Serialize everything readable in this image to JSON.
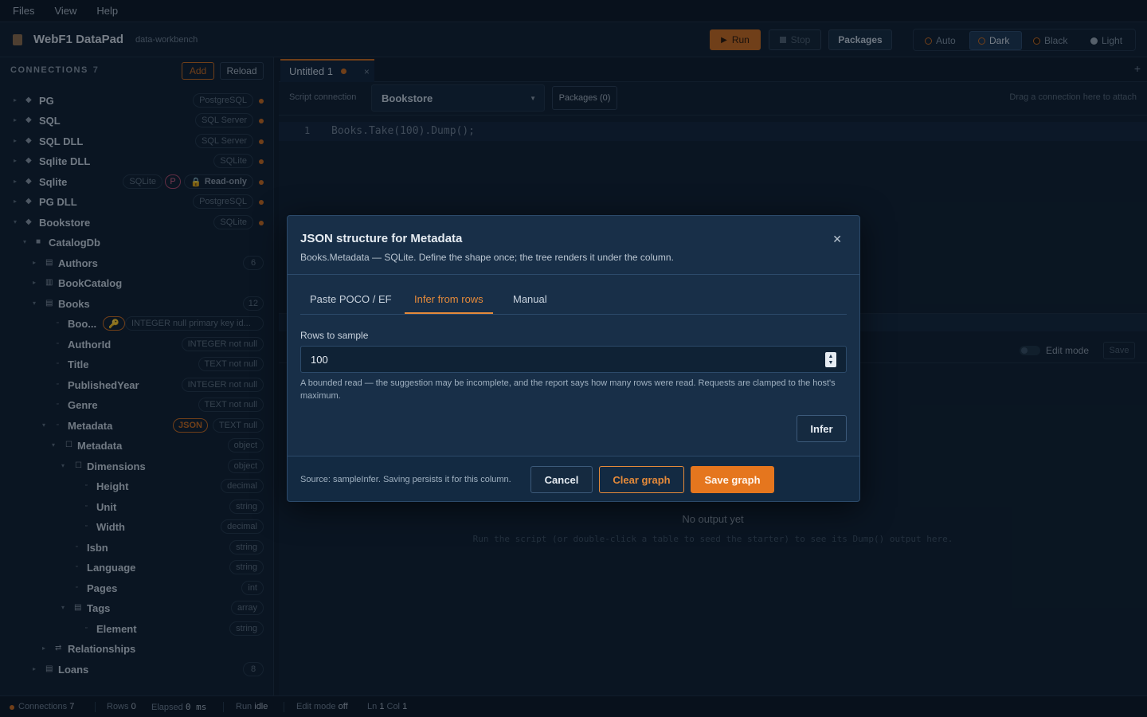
{
  "menu": [
    "Files",
    "View",
    "Help"
  ],
  "app": {
    "title": "WebF1 DataPad",
    "subtitle": "data-workbench"
  },
  "toolbar": {
    "run": "Run",
    "stop": "Stop",
    "packages": "Packages"
  },
  "themes": [
    "Auto",
    "Dark",
    "Black",
    "Light"
  ],
  "sidebar": {
    "title": "CONNECTIONS",
    "count": "7",
    "add": "Add",
    "reload": "Reload",
    "rows": [
      {
        "label": "PG",
        "tag": "PostgreSQL"
      },
      {
        "label": "SQL",
        "tag": "SQL Server"
      },
      {
        "label": "SQL DLL",
        "tag": "SQL Server"
      },
      {
        "label": "Sqlite DLL",
        "tag": "SQLite"
      },
      {
        "label": "Sqlite",
        "tag": "SQLite",
        "badge": "P",
        "readonly": "Read-only"
      },
      {
        "label": "PG DLL",
        "tag": "PostgreSQL"
      },
      {
        "label": "Bookstore",
        "tag": "SQLite"
      },
      {
        "label": "CatalogDb"
      },
      {
        "label": "Authors",
        "count": "6"
      },
      {
        "label": "BookCatalog"
      },
      {
        "label": "Books",
        "count": "12"
      },
      {
        "label": "Boo...",
        "type": "INTEGER null primary key id..."
      },
      {
        "label": "AuthorId",
        "type": "INTEGER not null"
      },
      {
        "label": "Title",
        "type": "TEXT not null"
      },
      {
        "label": "PublishedYear",
        "type": "INTEGER not null"
      },
      {
        "label": "Genre",
        "type": "TEXT not null"
      },
      {
        "label": "Metadata",
        "json": "JSON",
        "type": "TEXT null"
      },
      {
        "label": "Metadata",
        "type": "object"
      },
      {
        "label": "Dimensions",
        "type": "object"
      },
      {
        "label": "Height",
        "type": "decimal"
      },
      {
        "label": "Unit",
        "type": "string"
      },
      {
        "label": "Width",
        "type": "decimal"
      },
      {
        "label": "Isbn",
        "type": "string"
      },
      {
        "label": "Language",
        "type": "string"
      },
      {
        "label": "Pages",
        "type": "int"
      },
      {
        "label": "Tags",
        "type": "array"
      },
      {
        "label": "Element",
        "type": "string"
      },
      {
        "label": "Relationships"
      },
      {
        "label": "Loans",
        "count": "8"
      }
    ]
  },
  "editor": {
    "tab": "Untitled 1",
    "script_label": "Script connection",
    "connection": "Bookstore",
    "packages": "Packages (0)",
    "drag_hint": "Drag a connection here to attach",
    "line_no": "1",
    "code": "Books.Take(100).Dump();",
    "edit_mode": "Edit mode",
    "save": "Save",
    "no_output": "No output yet",
    "no_output_hint": "Run the script (or double-click a table to seed the starter) to see its Dump() output here."
  },
  "status": {
    "connections_label": "Connections",
    "connections": "7",
    "rows_label": "Rows",
    "rows": "0",
    "elapsed_label": "Elapsed",
    "elapsed": "0 ms",
    "run_label": "Run",
    "run": "idle",
    "edit_label": "Edit mode",
    "edit": "off",
    "ln_label": "Ln",
    "ln": "1",
    "col_label": "Col",
    "col": "1"
  },
  "modal": {
    "title": "JSON structure for Metadata",
    "subtitle": "Books.Metadata — SQLite. Define the shape once; the tree renders it under the column.",
    "tabs": [
      "Paste POCO / EF",
      "Infer from rows",
      "Manual"
    ],
    "rows_label": "Rows to sample",
    "rows_value": "100",
    "help": "A bounded read — the suggestion may be incomplete, and the report says how many rows were read. Requests are clamped to the host's maximum.",
    "infer": "Infer",
    "source": "Source: sampleInfer. Saving persists it for this column.",
    "cancel": "Cancel",
    "clear": "Clear graph",
    "save": "Save graph"
  },
  "colors": {
    "accent": "#e5761e",
    "background": "#0f1e2e",
    "modal": "#182f48"
  }
}
